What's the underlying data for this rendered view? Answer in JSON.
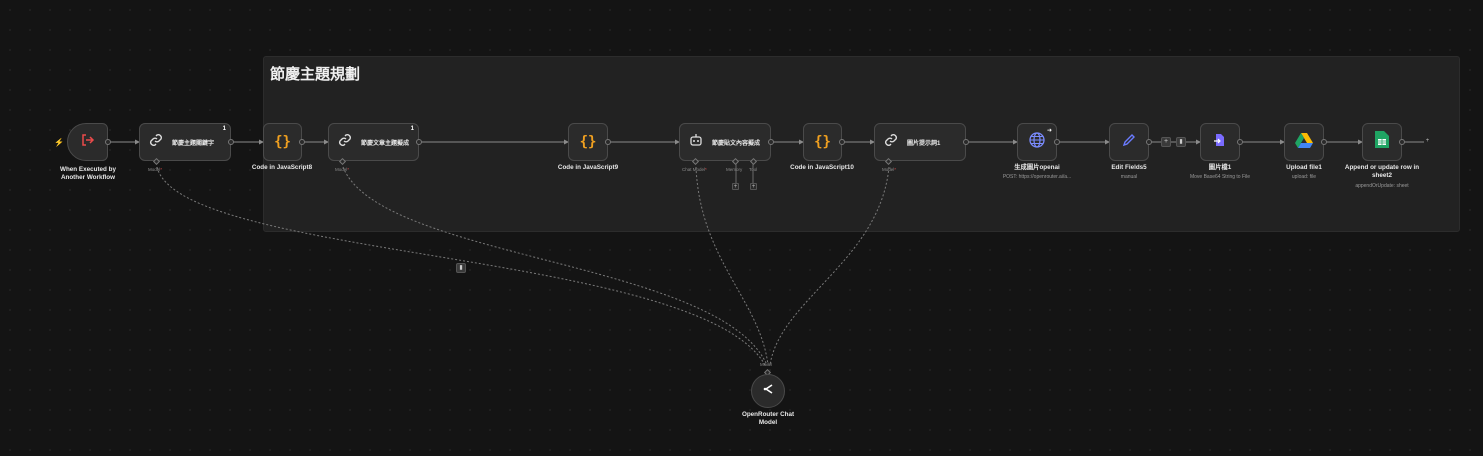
{
  "sticky": {
    "title": "節慶主題規劃"
  },
  "nodes": {
    "trigger": {
      "caption_line1": "When Executed by",
      "caption_line2": "Another Workflow",
      "icon": "sign-in-arrow-icon",
      "color": "#ea4b4b"
    },
    "keyword": {
      "label": "節慶主題關鍵字",
      "badge": "1",
      "port": "Model",
      "icon": "link-chain-icon"
    },
    "js8": {
      "caption": "Code in JavaScript8",
      "icon": "braces-icon",
      "color": "#f0a020"
    },
    "article": {
      "label": "節慶文章主題擬成",
      "badge": "1",
      "port": "Model",
      "icon": "link-chain-icon"
    },
    "js9": {
      "caption": "Code in JavaScript9",
      "icon": "braces-icon"
    },
    "agent": {
      "label": "節慶貼文內容擬成",
      "ports": [
        "Chat Model",
        "Memory",
        "Tool"
      ],
      "icon": "robot-icon"
    },
    "js10": {
      "caption": "Code in JavaScript10",
      "icon": "braces-icon"
    },
    "prompt": {
      "label": "圖片提示詞1",
      "port": "Model",
      "icon": "link-chain-icon"
    },
    "http": {
      "caption": "生成圖片openai",
      "sub": "POST: https://openrouter.ai/a...",
      "icon": "globe-icon",
      "color": "#7b8cff"
    },
    "edit": {
      "caption": "Edit Fields5",
      "sub": "manual",
      "icon": "pencil-icon",
      "color": "#6a7bff"
    },
    "convert": {
      "caption": "圖片檔1",
      "sub": "Move Base64 String to File",
      "icon": "file-convert-icon",
      "color": "#7a6bff"
    },
    "upload": {
      "caption": "Upload file1",
      "sub": "upload: file",
      "icon": "google-drive-icon"
    },
    "sheets": {
      "caption_line1": "Append or update row in",
      "caption_line2": "sheet2",
      "sub": "appendOrUpdate: sheet",
      "icon": "google-sheets-icon",
      "color": "#1fa463"
    },
    "openrouter": {
      "caption_line1": "OpenRouter Chat",
      "caption_line2": "Model",
      "port": "Model",
      "icon": "openrouter-icon"
    }
  },
  "edge_buttons": {
    "add": "+",
    "delete": "🗑"
  },
  "colors": {
    "edge": "#8a8a8a",
    "node_bg": "#2b2b2b",
    "node_border": "#4a4a4a",
    "required": "#e05050"
  }
}
